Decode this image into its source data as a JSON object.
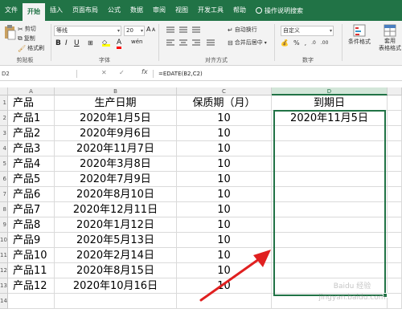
{
  "tabs": [
    {
      "label": "文件",
      "active": false
    },
    {
      "label": "开始",
      "active": true
    },
    {
      "label": "插入",
      "active": false
    },
    {
      "label": "页面布局",
      "active": false
    },
    {
      "label": "公式",
      "active": false
    },
    {
      "label": "数据",
      "active": false
    },
    {
      "label": "审阅",
      "active": false
    },
    {
      "label": "视图",
      "active": false
    },
    {
      "label": "开发工具",
      "active": false
    },
    {
      "label": "帮助",
      "active": false
    }
  ],
  "tell_me": "操作说明搜索",
  "ribbon": {
    "clipboard": {
      "cut": "剪切",
      "copy": "复制",
      "format_painter": "格式刷",
      "label": "剪贴板"
    },
    "font": {
      "name": "等线",
      "size": "20",
      "bold": "B",
      "italic": "I",
      "underline": "U",
      "grow": "A",
      "shrink": "A",
      "color_glyph": "A",
      "wen": "wén",
      "label": "字体"
    },
    "alignment": {
      "wrap": "自动换行",
      "merge": "合并后居中",
      "label": "对齐方式"
    },
    "number": {
      "format": "自定义",
      "label": "数字"
    },
    "styles": {
      "conditional": "条件格式",
      "table": "套用\n表格格式"
    }
  },
  "formula_bar": {
    "name_box": "D2",
    "formula": "=EDATE(B2,C2)"
  },
  "columns": [
    "A",
    "B",
    "C",
    "D"
  ],
  "row_numbers": [
    "1",
    "2",
    "3",
    "4",
    "5",
    "6",
    "7",
    "8",
    "9",
    "10",
    "11",
    "12",
    "13",
    "14"
  ],
  "headers": {
    "product": "产品",
    "date": "生产日期",
    "period": "保质期（月）",
    "expiry": "到期日"
  },
  "rows": [
    {
      "product": "产品1",
      "date": "2020年1月5日",
      "period": "10",
      "expiry": "2020年11月5日"
    },
    {
      "product": "产品2",
      "date": "2020年9月6日",
      "period": "10",
      "expiry": ""
    },
    {
      "product": "产品3",
      "date": "2020年11月7日",
      "period": "10",
      "expiry": ""
    },
    {
      "product": "产品4",
      "date": "2020年3月8日",
      "period": "10",
      "expiry": ""
    },
    {
      "product": "产品5",
      "date": "2020年7月9日",
      "period": "10",
      "expiry": ""
    },
    {
      "product": "产品6",
      "date": "2020年8月10日",
      "period": "10",
      "expiry": ""
    },
    {
      "product": "产品7",
      "date": "2020年12月11日",
      "period": "10",
      "expiry": ""
    },
    {
      "product": "产品8",
      "date": "2020年1月12日",
      "period": "10",
      "expiry": ""
    },
    {
      "product": "产品9",
      "date": "2020年5月13日",
      "period": "10",
      "expiry": ""
    },
    {
      "product": "产品10",
      "date": "2020年2月14日",
      "period": "10",
      "expiry": ""
    },
    {
      "product": "产品11",
      "date": "2020年8月15日",
      "period": "10",
      "expiry": ""
    },
    {
      "product": "产品12",
      "date": "2020年10月16日",
      "period": "10",
      "expiry": ""
    }
  ],
  "accent_color": "#217346",
  "arrow_color": "#e02020",
  "watermark": "Baidu 经验\njingyan.baidu.com"
}
